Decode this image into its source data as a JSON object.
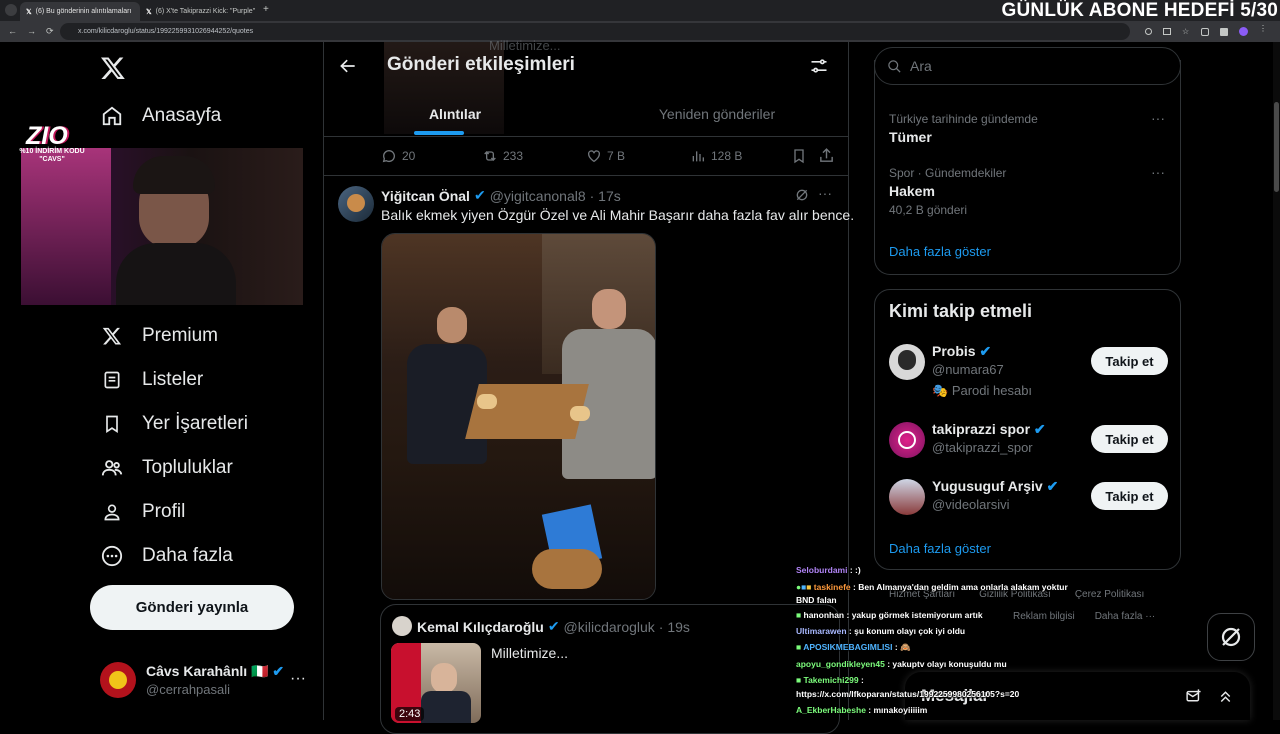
{
  "browser": {
    "tabs": [
      {
        "title": "(6) Bu gönderinin alıntılamaları"
      },
      {
        "title": "(6) X'te Takiprazzi Kick: \"Purple\""
      }
    ],
    "url": "x.com/kilicdaroglu/status/1992259931026944252/quotes",
    "banner": "GÜNLÜK ABONE HEDEFİ 5/30"
  },
  "overlay": {
    "logo": "ZIO",
    "promo_line1": "%10 İNDİRİM KODU",
    "promo_line2": "\"CAVS\""
  },
  "sidebar": {
    "items": [
      {
        "label": "Anasayfa",
        "icon": "home-icon"
      },
      {
        "label": "Premium",
        "icon": "x-logo-icon"
      },
      {
        "label": "Listeler",
        "icon": "list-icon"
      },
      {
        "label": "Yer İşaretleri",
        "icon": "bookmark-icon"
      },
      {
        "label": "Topluluklar",
        "icon": "communities-icon"
      },
      {
        "label": "Profil",
        "icon": "profile-icon"
      },
      {
        "label": "Daha fazla",
        "icon": "more-circle-icon"
      }
    ],
    "post_button": "Gönderi yayınla",
    "account": {
      "name": "Câvs Karahânlı 🇮🇹",
      "handle": "@cerrahpasali"
    }
  },
  "header": {
    "title": "Gönderi etkileşimleri",
    "ghost_text": "Milletimize...",
    "tabs": [
      {
        "label": "Alıntılar",
        "active": true
      },
      {
        "label": "Yeniden gönderiler",
        "active": false
      }
    ]
  },
  "original_stats": {
    "replies": "20",
    "reposts": "233",
    "likes": "7 B",
    "views": "128 B"
  },
  "quote_post": {
    "name": "Yiğitcan Önal",
    "handle": "@yigitcanonal8",
    "time": "· 17s",
    "text": "Balık ekmek yiyen Özgür Özel ve Ali Mahir Başarır daha fazla fav alır bence.",
    "embedded": {
      "name": "Kemal Kılıçdaroğlu",
      "handle": "@kilicdarogluk",
      "time": "· 19s",
      "text": "Milletimize...",
      "video_duration": "2:43"
    }
  },
  "right": {
    "search_placeholder": "Ara",
    "trends": [
      {
        "context": "Türkiye tarihinde gündemde",
        "name": "Tümer",
        "count": ""
      },
      {
        "context": "Spor · Gündemdekiler",
        "name": "Hakem",
        "count": "40,2 B gönderi"
      }
    ],
    "show_more": "Daha fazla göster",
    "who_to_follow": {
      "title": "Kimi takip etmeli",
      "users": [
        {
          "name": "Probis",
          "handle": "@numara67",
          "extra": "Parodi hesabı",
          "button": "Takip et"
        },
        {
          "name": "takiprazzi spor",
          "handle": "@takiprazzi_spor",
          "extra": "",
          "button": "Takip et"
        },
        {
          "name": "Yugusuguf Arşiv",
          "handle": "@videolarsivi",
          "extra": "",
          "button": "Takip et"
        }
      ],
      "show_more": "Daha fazla göster"
    },
    "footer": [
      "Hizmet Şartları",
      "Gizlilik Politikası",
      "Çerez Politikası",
      "Reklam bilgisi",
      "Daha fazla ···"
    ],
    "messages_label": "Mesajlar"
  },
  "chat": [
    {
      "user": "Seloburdami",
      "color": "#b084f5",
      "msg": ": :)"
    },
    {
      "user": "taskinefe",
      "color": "#ff9a3c",
      "msg": ": Ben Almanya'dan geldim ama onlarla alakam yoktur BND falan"
    },
    {
      "user": "hanonhan",
      "color": "#ffffff",
      "msg": ": yakup görmek istemiyorum artık"
    },
    {
      "user": "Ultimarawen",
      "color": "#a8b8ff",
      "msg": ": şu konum olayı çok iyi oldu"
    },
    {
      "user": "APOSIKMEBAGIMLISI",
      "color": "#4fb4ff",
      "msg": ": 🙈"
    },
    {
      "user": "apoyu_gondikleyen45",
      "color": "#7cfc7c",
      "msg": ": yakuptv olayı konuşuldu mu"
    },
    {
      "user": "Takemichi299",
      "color": "#7cfc7c",
      "msg": ":"
    },
    {
      "user": "",
      "color": "#ffffff",
      "msg": "https://x.com/lfkoparan/status/1992259980256105?s=20"
    },
    {
      "user": "A_EkberHabeshe",
      "color": "#7cfc7c",
      "msg": ": mınakoyiiiiim"
    }
  ],
  "colors": {
    "accent": "#1d9bf0",
    "background": "#000000",
    "border": "#2f3336",
    "muted": "#71767b"
  }
}
